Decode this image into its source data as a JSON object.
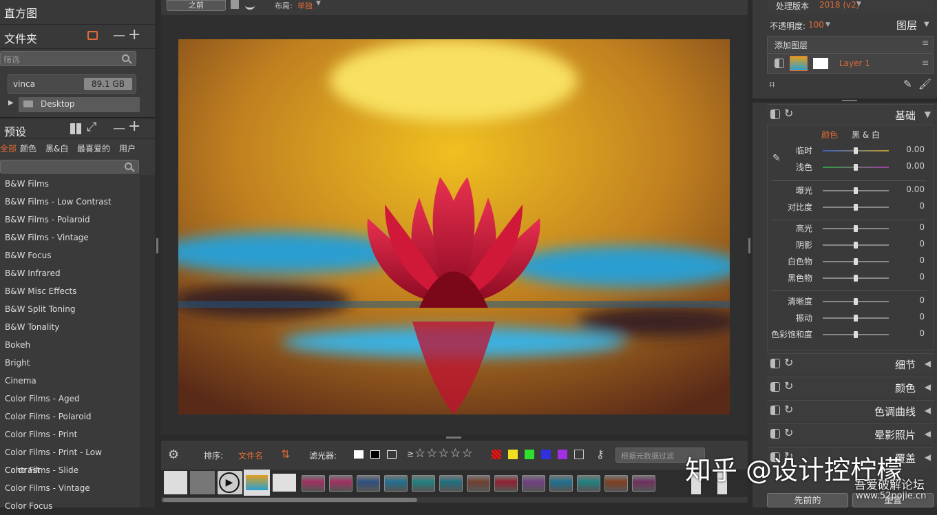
{
  "left": {
    "histogram_title": "直方图",
    "folder_title": "文件夹",
    "filter_placeholder": "筛选",
    "drive_name": "vinca",
    "drive_size": "89.1 GB",
    "desktop": "Desktop",
    "presets_title": "预设",
    "preset_tabs": [
      "全部",
      "颜色",
      "黑&白",
      "最喜爱的",
      "用户"
    ],
    "presets": [
      "B&W Films",
      "B&W Films - Low Contrast",
      "B&W Films - Polaroid",
      "B&W Films - Vintage",
      "B&W Focus",
      "B&W Infrared",
      "B&W Misc Effects",
      "B&W Split Toning",
      "B&W Tonality",
      "Bokeh",
      "Bright",
      "Cinema",
      "Color Films - Aged",
      "Color Films - Polaroid",
      "Color Films - Print",
      "Color Films - Print - Low Contrast",
      "Color Films - Slide",
      "Color Films - Vintage",
      "Color Focus"
    ]
  },
  "top": {
    "before_label": "之前",
    "layout_label": "布局:",
    "layout_value": "单独"
  },
  "toolbar": {
    "sort_label": "排序:",
    "sort_value": "文件名",
    "filter_label": "滤光器:",
    "ge": "≥",
    "stars": "☆☆☆☆☆",
    "meta_placeholder": "根据元数据过滤"
  },
  "right": {
    "version_label": "处理版本",
    "version_value": "2018 (v2)",
    "opacity_label": "不透明度:",
    "opacity_value": "100",
    "layers_title": "图层",
    "add_layer": "添加图层",
    "layer_name": "Layer 1",
    "basic_title": "基础",
    "tab_color": "颜色",
    "tab_bw": "黑 & 白",
    "sliders": [
      {
        "label": "临时",
        "value": "0.00"
      },
      {
        "label": "浅色",
        "value": "0.00"
      },
      {
        "label": "曝光",
        "value": "0.00"
      },
      {
        "label": "对比度",
        "value": "0"
      },
      {
        "label": "高光",
        "value": "0"
      },
      {
        "label": "阴影",
        "value": "0"
      },
      {
        "label": "白色物",
        "value": "0"
      },
      {
        "label": "黑色物",
        "value": "0"
      },
      {
        "label": "清晰度",
        "value": "0"
      },
      {
        "label": "振动",
        "value": "0"
      },
      {
        "label": "色彩饱和度",
        "value": "0"
      }
    ],
    "sections": [
      "细节",
      "颜色",
      "色调曲线",
      "晕影照片",
      "覆盖"
    ],
    "prev_button": "先前的",
    "reset_button": "重置"
  },
  "watermark": {
    "text": "知乎 @设计控柠檬",
    "forum": "吾爱破解论坛",
    "url": "www.52pojie.cn"
  },
  "colors": {
    "accent": "#e06b37",
    "panel": "#3a3a3a"
  }
}
